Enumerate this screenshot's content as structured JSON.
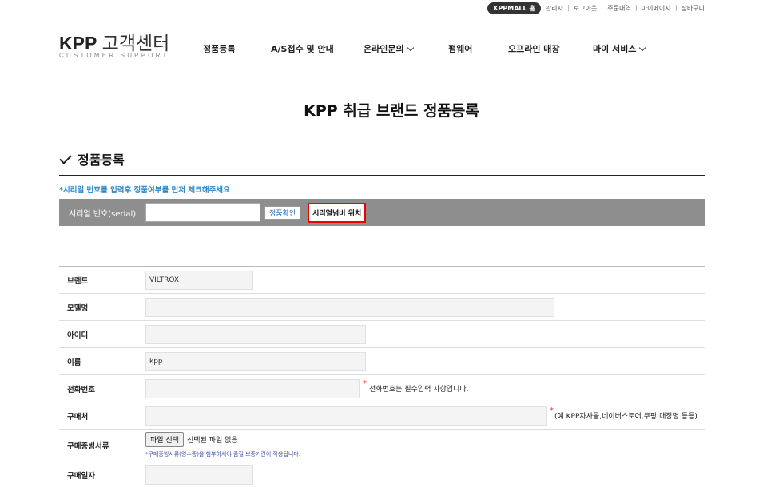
{
  "topbar": {
    "mall": "KPPMALL 홈",
    "links": [
      "관리자",
      "로그아웃",
      "주문내역",
      "마이페이지",
      "장바구니"
    ]
  },
  "logo": {
    "main_bold": "KPP",
    "main_rest": " 고객센터",
    "sub": "CUSTOMER SUPPORT"
  },
  "nav": [
    {
      "label": "정품등록"
    },
    {
      "label": "A/S접수 및 안내"
    },
    {
      "label": "온라인문의",
      "dropdown": true
    },
    {
      "label": "펌웨어"
    },
    {
      "label": "오프라인 매장"
    },
    {
      "label": "마이 서비스",
      "dropdown": true
    }
  ],
  "page_title": "KPP 취급 브랜드 정품등록",
  "section_title": "정품등록",
  "notice": "*시리얼 번호를 입력후 정품여부를 먼저 체크해주세요",
  "serial": {
    "label": "시리얼 번호(serial)",
    "value": "",
    "check_button": "정품확인",
    "location_button": "시리얼넘버 위치"
  },
  "form": {
    "brand": {
      "label": "브랜드",
      "value": "VILTROX"
    },
    "model": {
      "label": "모델명",
      "value": ""
    },
    "user_id": {
      "label": "아이디",
      "value": ""
    },
    "name": {
      "label": "이름",
      "value": "kpp"
    },
    "phone": {
      "label": "전화번호",
      "value": "",
      "required": "*",
      "hint": "전화번호는 필수입력 사항입니다."
    },
    "store": {
      "label": "구매처",
      "value": "",
      "required": "*",
      "hint": "(예.KPP자사몰,네이버스토어,쿠팡,매장명 등등)"
    },
    "receipt": {
      "label": "구매증빙서류",
      "button": "파일 선택",
      "status": "선택된 파일 없음",
      "note": "*구매증빙서류(영수증)을 첨부하셔야 품질 보증기간이 적용됩니다."
    },
    "purchase_date": {
      "label": "구매일자",
      "value": ""
    }
  },
  "colors": {
    "accent_blue": "#2a87c9",
    "serial_bar": "#8e8e8e",
    "highlight_red": "#ee0000",
    "title_highlight": "#f3e3c8"
  }
}
